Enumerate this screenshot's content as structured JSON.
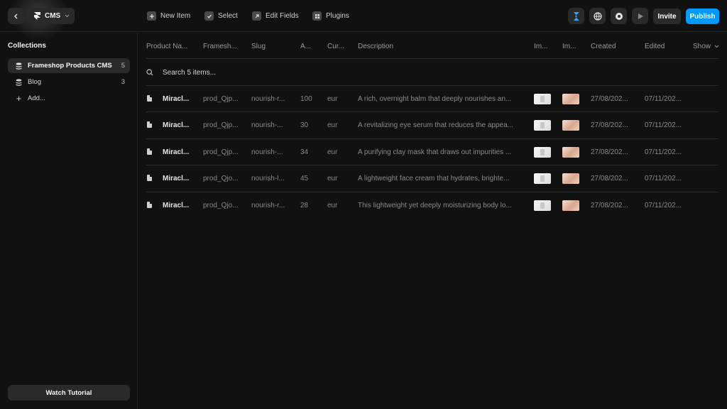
{
  "toolbar": {
    "project_label": "CMS",
    "new_item": "New Item",
    "select": "Select",
    "edit_fields": "Edit Fields",
    "plugins": "Plugins",
    "invite": "Invite",
    "publish": "Publish",
    "accent": "#0099ff"
  },
  "sidebar": {
    "title": "Collections",
    "items": [
      {
        "label": "Frameshop Products CMS",
        "count": "5"
      },
      {
        "label": "Blog",
        "count": "3"
      }
    ],
    "add_label": "Add...",
    "tutorial": "Watch Tutorial"
  },
  "table": {
    "columns": [
      "Product Na...",
      "Framesh...",
      "Slug",
      "A...",
      "Cur...",
      "Description",
      "Im...",
      "Im...",
      "Created",
      "Edited",
      "Show"
    ],
    "search_placeholder": "Search 5 items...",
    "rows": [
      {
        "name": "Miracl...",
        "frameshop": "prod_Qjp...",
        "slug": "nourish-r...",
        "amount": "100",
        "currency": "eur",
        "description": "A rich, overnight balm that deeply nourishes an...",
        "created": "27/08/202...",
        "edited": "07/11/202..."
      },
      {
        "name": "Miracl...",
        "frameshop": "prod_Qjp...",
        "slug": "nourish-...",
        "amount": "30",
        "currency": "eur",
        "description": "A revitalizing eye serum that reduces the appea...",
        "created": "27/08/202...",
        "edited": "07/11/202..."
      },
      {
        "name": "Miracl...",
        "frameshop": "prod_Qjp...",
        "slug": "nourish-...",
        "amount": "34",
        "currency": "eur",
        "description": "A purifying clay mask that draws out impurities ...",
        "created": "27/08/202...",
        "edited": "07/11/202..."
      },
      {
        "name": "Miracl...",
        "frameshop": "prod_Qjo...",
        "slug": "nourish-l...",
        "amount": "45",
        "currency": "eur",
        "description": "A lightweight face cream that hydrates, brighte...",
        "created": "27/08/202...",
        "edited": "07/11/202..."
      },
      {
        "name": "Miracl...",
        "frameshop": "prod_Qjo...",
        "slug": "nourish-r...",
        "amount": "28",
        "currency": "eur",
        "description": "This lightweight yet deeply moisturizing body lo...",
        "created": "27/08/202...",
        "edited": "07/11/202..."
      }
    ]
  }
}
